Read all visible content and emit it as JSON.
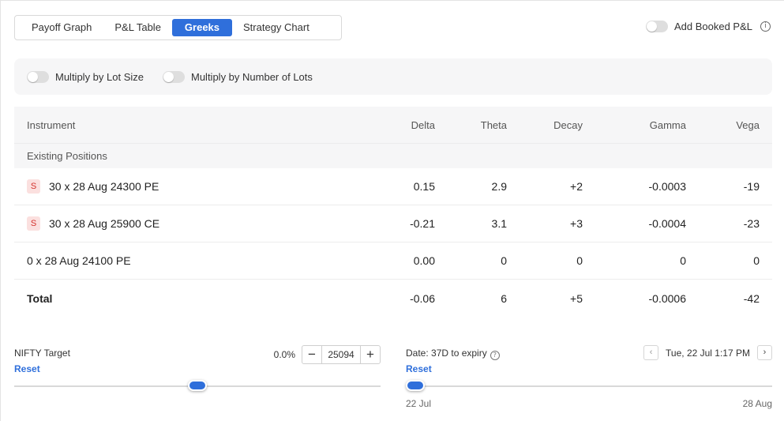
{
  "tabs": [
    {
      "label": "Payoff Graph"
    },
    {
      "label": "P&L Table"
    },
    {
      "label": "Greeks"
    },
    {
      "label": "Strategy Chart"
    }
  ],
  "active_tab": "Greeks",
  "booked_pl": {
    "label": "Add Booked P&L",
    "enabled": false
  },
  "multiply": {
    "lot_size_label": "Multiply by Lot Size",
    "lots_label": "Multiply by Number of Lots"
  },
  "table": {
    "headers": {
      "instrument": "Instrument",
      "delta": "Delta",
      "theta": "Theta",
      "decay": "Decay",
      "gamma": "Gamma",
      "vega": "Vega"
    },
    "section_label": "Existing Positions",
    "rows": [
      {
        "side": "S",
        "instrument": "30 x 28 Aug 24300 PE",
        "delta": "0.15",
        "theta": "2.9",
        "decay": "+2",
        "gamma": "-0.0003",
        "vega": "-19"
      },
      {
        "side": "S",
        "instrument": "30 x 28 Aug 25900 CE",
        "delta": "-0.21",
        "theta": "3.1",
        "decay": "+3",
        "gamma": "-0.0004",
        "vega": "-23"
      },
      {
        "side": "",
        "instrument": "0 x 28 Aug 24100 PE",
        "delta": "0.00",
        "theta": "0",
        "decay": "0",
        "gamma": "0",
        "vega": "0"
      }
    ],
    "total": {
      "label": "Total",
      "delta": "-0.06",
      "theta": "6",
      "decay": "+5",
      "gamma": "-0.0006",
      "vega": "-42"
    }
  },
  "target": {
    "label": "NIFTY Target",
    "reset_label": "Reset",
    "percent": "0.0%",
    "value": "25094",
    "minus": "−",
    "plus": "+",
    "slider_fraction": 0.5
  },
  "date": {
    "label": "Date: 37D to expiry",
    "reset_label": "Reset",
    "current": "Tue, 22 Jul 1:17 PM",
    "start_label": "22 Jul",
    "end_label": "28 Aug",
    "slider_fraction": 0.0
  },
  "colors": {
    "accent": "#2f6fdb",
    "sell_badge_bg": "#fbe0df",
    "sell_badge_text": "#d3322d"
  }
}
